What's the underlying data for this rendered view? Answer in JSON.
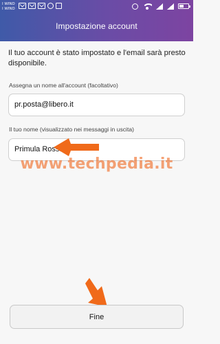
{
  "status_bar": {
    "carrier_1": "I WIND",
    "carrier_2": "I WIND",
    "left_icons": [
      "envelope-icon",
      "envelope-icon",
      "envelope-icon",
      "whatsapp-icon",
      "image-icon"
    ],
    "right_icons": [
      "alarm-icon",
      "wifi-icon",
      "signal-icon",
      "signal-icon",
      "battery-icon"
    ]
  },
  "header": {
    "title": "Impostazione account",
    "gradient_start": "#3f5aa8",
    "gradient_end": "#7d44a1"
  },
  "main": {
    "intro": "Il tuo account è stato impostato e l'email sarà presto disponibile.",
    "account_name": {
      "label": "Assegna un nome all'account (facoltativo)",
      "value": "pr.posta@libero.it"
    },
    "your_name": {
      "label": "Il tuo nome (visualizzato nei messaggi in uscita)",
      "value": "Primula Rossa"
    },
    "finish_button": "Fine"
  },
  "overlay": {
    "watermark": "www.techpedia.it",
    "arrow_color": "#f06a1a"
  }
}
